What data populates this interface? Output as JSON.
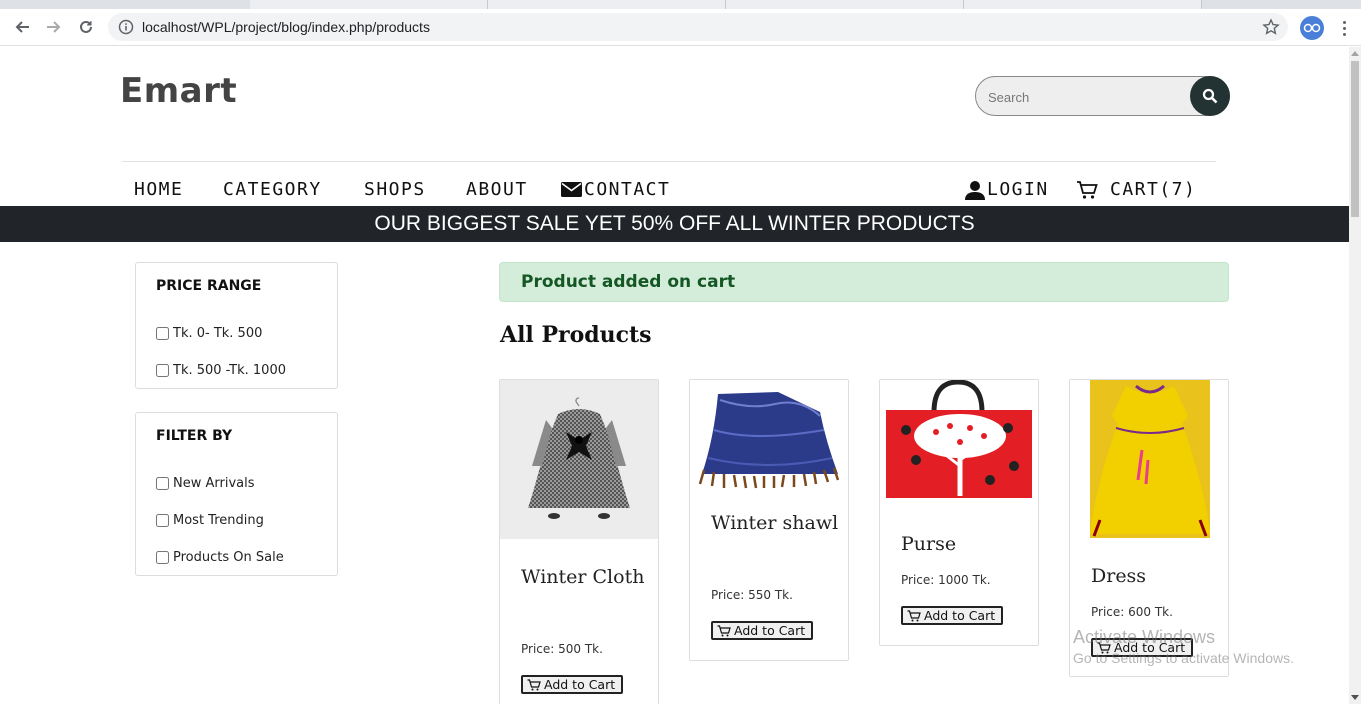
{
  "browser": {
    "url": "localhost/WPL/project/blog/index.php/products"
  },
  "site": {
    "logo": "Emart",
    "search_placeholder": "Search"
  },
  "nav": {
    "home": "HOME",
    "category": "CATEGORY",
    "shops": "SHOPS",
    "about": "ABOUT",
    "contact": "CONTACT",
    "login": "LOGIN",
    "cart": "CART(7)"
  },
  "banner": "OUR BIGGEST SALE YET 50% OFF ALL WINTER PRODUCTS",
  "sidebar": {
    "price_range": {
      "title": "PRICE RANGE",
      "options": [
        "Tk. 0- Tk. 500",
        "Tk. 500 -Tk. 1000"
      ]
    },
    "filter_by": {
      "title": "FILTER BY",
      "options": [
        "New Arrivals",
        "Most Trending",
        "Products On Sale"
      ]
    }
  },
  "alert": "Product added on cart",
  "section_title": "All Products",
  "products": [
    {
      "name": "Winter Cloth",
      "price": "Price: 500 Tk.",
      "button": "Add to Cart"
    },
    {
      "name": "Winter shawl",
      "price": "Price: 550 Tk.",
      "button": "Add to Cart"
    },
    {
      "name": "Purse",
      "price": "Price: 1000 Tk.",
      "button": "Add to Cart"
    },
    {
      "name": "Dress",
      "price": "Price: 600 Tk.",
      "button": "Add to Cart"
    }
  ],
  "watermark": {
    "line1": "Activate Windows",
    "line2": "Go to Settings to activate Windows."
  },
  "colors": {
    "banner_bg": "#212529",
    "alert_bg": "#d4edda",
    "alert_text": "#155724",
    "search_button": "#233232"
  }
}
